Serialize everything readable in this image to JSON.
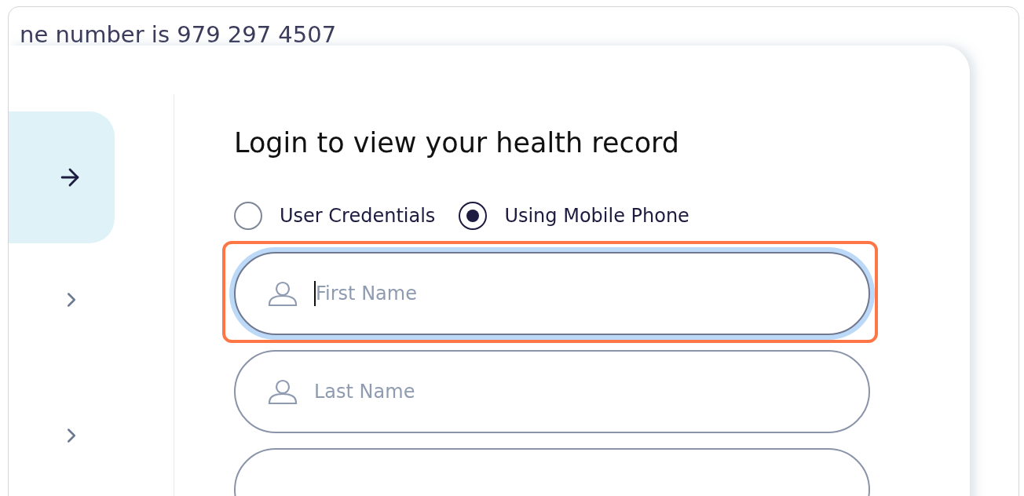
{
  "intro_text": "ne number is 979 297 4507",
  "sidebar": {
    "items": [
      {
        "kind": "arrow",
        "selected": true
      },
      {
        "kind": "chevron",
        "selected": false
      },
      {
        "kind": "chevron",
        "selected": false
      }
    ]
  },
  "login": {
    "title": "Login to view your health record",
    "methods": [
      {
        "label": "User Credentials",
        "selected": false
      },
      {
        "label": "Using Mobile Phone",
        "selected": true
      }
    ],
    "fields": [
      {
        "placeholder": "First Name",
        "focused": true,
        "highlighted": true
      },
      {
        "placeholder": "Last Name",
        "focused": false,
        "highlighted": false
      },
      {
        "focused": false,
        "highlighted": false
      }
    ]
  }
}
